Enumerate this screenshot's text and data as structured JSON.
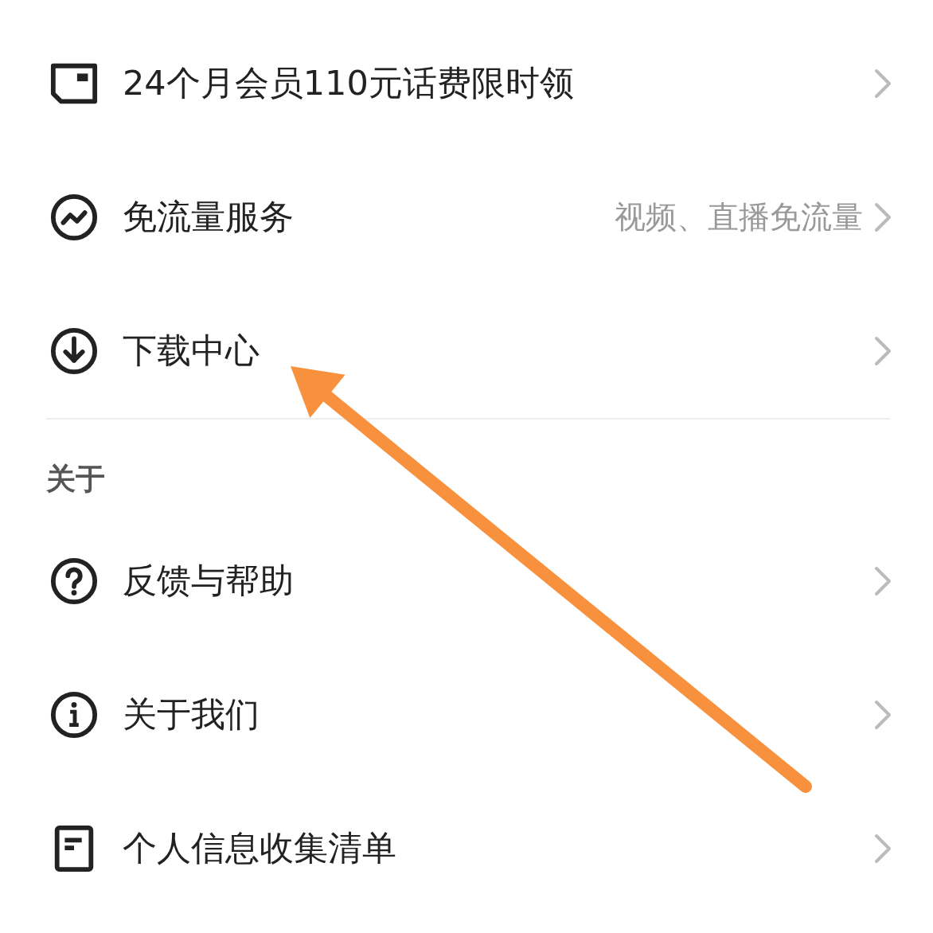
{
  "sections": [
    {
      "items": [
        {
          "kind": "card",
          "label": "24个月会员110元话费限时领"
        },
        {
          "kind": "traffic",
          "label": "免流量服务",
          "detail": "视频、直播免流量"
        },
        {
          "kind": "download",
          "label": "下载中心"
        }
      ]
    },
    {
      "header": "关于",
      "items": [
        {
          "kind": "help",
          "label": "反馈与帮助"
        },
        {
          "kind": "info",
          "label": "关于我们"
        },
        {
          "kind": "document",
          "label": "个人信息收集清单"
        }
      ]
    }
  ]
}
